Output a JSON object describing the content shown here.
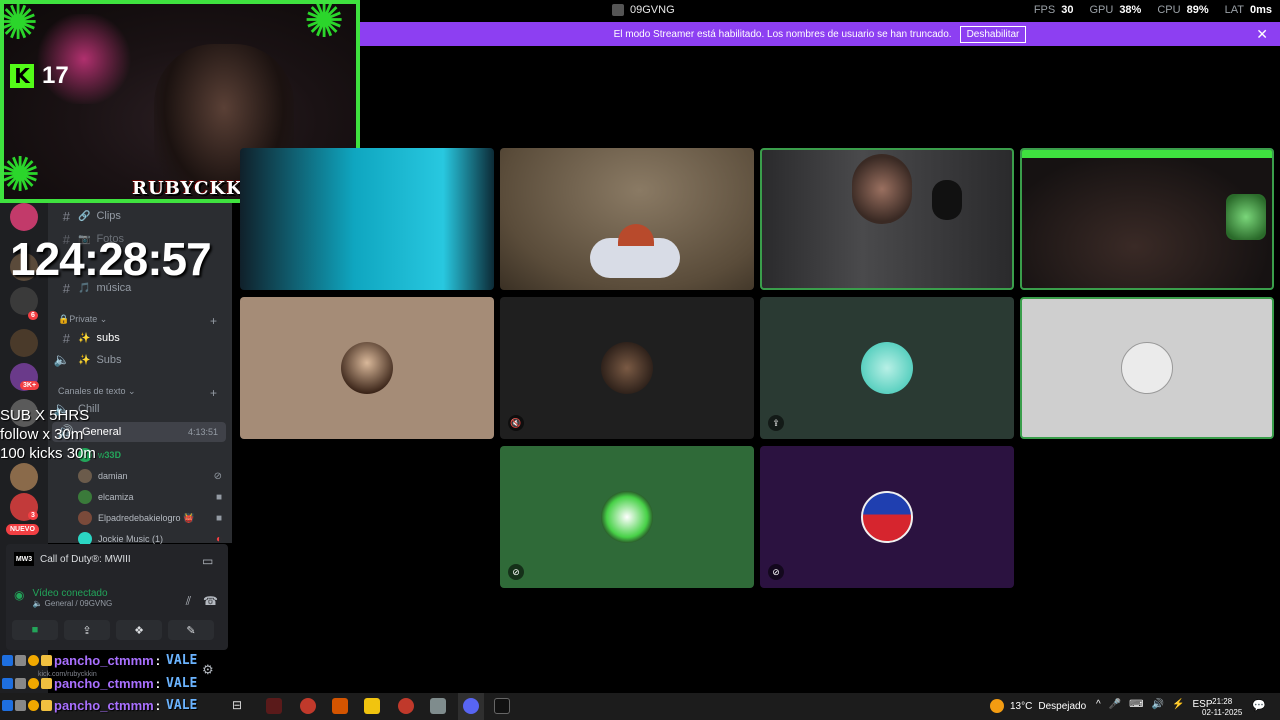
{
  "window": {
    "title": "09GVNG"
  },
  "perf": [
    {
      "label": "FPS",
      "value": "30"
    },
    {
      "label": "GPU",
      "value": "38%"
    },
    {
      "label": "CPU",
      "value": "89%"
    },
    {
      "label": "LAT",
      "value": "0ms"
    }
  ],
  "banner": {
    "text": "El modo Streamer está habilitado. Los nombres de usuario se han truncado.",
    "button": "Deshabilitar",
    "close": "✕"
  },
  "webcam": {
    "kick_count": "17",
    "name_overlay": "RUBYCKKIN",
    "kick_logo": "K"
  },
  "overlay": {
    "timer": "124:28:57",
    "goals": [
      "SUB X 5HRS",
      "follow x 30m",
      "100 kicks 30m"
    ]
  },
  "servers": {
    "badges": [
      "6",
      "3K+",
      "3"
    ],
    "nuevo": "NUEVO"
  },
  "channels": {
    "items": [
      {
        "label": "Clips",
        "icon": "🔗"
      },
      {
        "label": "Fotos",
        "icon": "📷"
      },
      {
        "label": "música",
        "icon": "🎵"
      }
    ],
    "cat_private": "🔒Private ⌄",
    "private_items": [
      {
        "label": "subs",
        "icon": "✨"
      },
      {
        "label": "Subs",
        "icon": "✨"
      }
    ],
    "cat_text": "Canales de texto ⌄",
    "voice_items": [
      {
        "label": "Chill"
      },
      {
        "label": "General",
        "time": "4:13:51"
      }
    ],
    "members": [
      {
        "name": "w𝟑𝟑𝐃",
        "color": "#23a55a"
      },
      {
        "name": "damian",
        "color": "#6b5b4b"
      },
      {
        "name": "elcamiza",
        "color": "#3a7a3a"
      },
      {
        "name": "Elpadredebakielogro 👹",
        "color": "#7a4a3a"
      },
      {
        "name": "Jockie Music (1)",
        "color": "#2bd6c4"
      }
    ]
  },
  "voice_panel": {
    "game": "Call of Duty®: MWIII",
    "game_tag": "MW3",
    "status": "Vídeo conectado",
    "location": "🔈 General / 09GVNG",
    "buttons": [
      "■",
      "⇪",
      "❖",
      "✎"
    ]
  },
  "chat": {
    "lines": [
      {
        "user": "pancho_ctmmm",
        "msg": "VALE"
      },
      {
        "user": "pancho_ctmmm",
        "msg": "VALE"
      },
      {
        "user": "pancho_ctmmm",
        "msg": "VALE"
      }
    ],
    "user_sub": "kick.com/rubyckkin"
  },
  "tiles": [
    {
      "type": "video",
      "color": "#0a3a4a",
      "status": ""
    },
    {
      "type": "video",
      "color": "#6e6150",
      "status": ""
    },
    {
      "type": "video",
      "color": "#2a2a2c",
      "status": ""
    },
    {
      "type": "video",
      "color": "#1b1a18",
      "status": ""
    },
    {
      "type": "avatar",
      "bg": "#a58c77",
      "av": "#3a2418",
      "status": ""
    },
    {
      "type": "avatar",
      "bg": "#1f1f1f",
      "av": "#3a2a22",
      "status": "🔇"
    },
    {
      "type": "avatar",
      "bg": "#2a3a33",
      "av": "#5ad0c0",
      "status": "⇪"
    },
    {
      "type": "avatar",
      "bg": "#cfcfcf",
      "av": "#e8e8e8",
      "status": ""
    },
    {
      "type": "avatar",
      "bg": "#2f6a38",
      "av": "#47d147",
      "status": "⊘"
    },
    {
      "type": "avatar",
      "bg": "#2b1240",
      "av": "#d6252e",
      "status": "⊘"
    }
  ],
  "taskbar": {
    "weather_temp": "13°C",
    "weather_text": "Despejado",
    "tray": [
      "^",
      "🎤",
      "⌨",
      "🔊",
      "⚡"
    ],
    "lang": "ESP",
    "time": "21:28",
    "date": "02-11-2025",
    "notif": "💬"
  },
  "colors": {
    "kick_green": "#53fc18",
    "discord_bg": "#2b2d31",
    "banner_purple": "#8d3ff2",
    "chat_user": "#a970ff",
    "chat_msg": "#6bb4ff"
  }
}
